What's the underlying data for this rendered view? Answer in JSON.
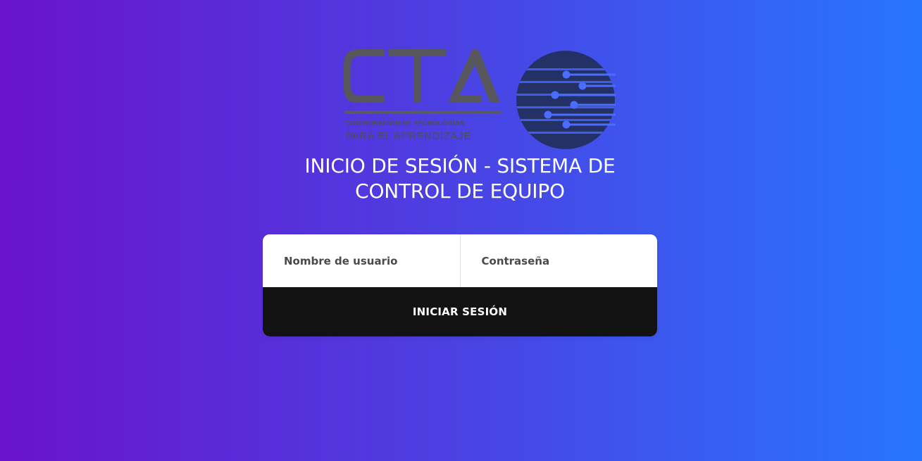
{
  "logo": {
    "letters": "CTA",
    "line1": "COORDINACIÓN DE TECNOLOGÍAS",
    "line2": "PARA EL APRENDIZAJE",
    "colors": {
      "letters": "#56565c",
      "globe": "#243167",
      "circuit": "#3e5ce8"
    }
  },
  "title": "INICIO DE SESIÓN - SISTEMA DE CONTROL DE EQUIPO",
  "form": {
    "username_placeholder": "Nombre de usuario",
    "password_placeholder": "Contraseña",
    "submit_label": "INICIAR SESIÓN"
  },
  "colors": {
    "gradient_start": "#6a13cd",
    "gradient_end": "#2775ff",
    "button_bg": "#121212",
    "card_bg": "#ffffff"
  }
}
